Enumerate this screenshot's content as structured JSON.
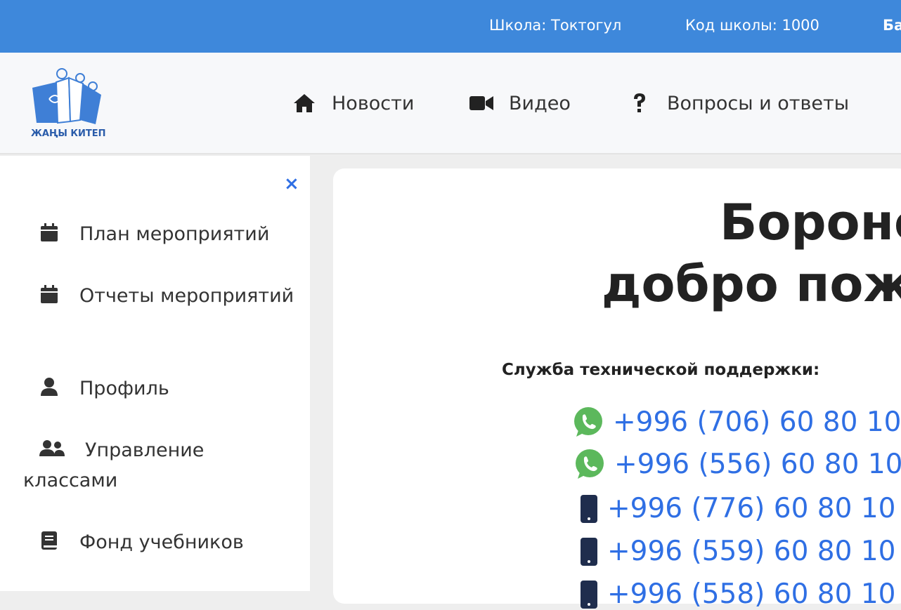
{
  "topbar": {
    "school": "Школа: Токтогул",
    "school_code": "Код школы: 1000",
    "cut_text": "Ба"
  },
  "logo": {
    "text": "ЖАҢЫ КИТЕП"
  },
  "nav": {
    "news": "Новости",
    "video": "Видео",
    "faq": "Вопросы и ответы"
  },
  "sidebar": {
    "close": "×",
    "items": [
      {
        "label": "План мероприятий",
        "icon": "calendar-icon"
      },
      {
        "label": "Отчеты мероприятий",
        "icon": "calendar-icon"
      },
      {
        "label": "Профиль",
        "icon": "user-icon"
      },
      {
        "label": "Управление классами",
        "icon": "users-icon"
      },
      {
        "label": "Фонд учебников",
        "icon": "book-icon"
      }
    ]
  },
  "main": {
    "title_line1": "Бороно",
    "title_line2": "добро пожа",
    "support_label": "Служба технической поддержки:",
    "phones": [
      {
        "number": "+996 (706) 60 80 10",
        "icon": "whatsapp-icon"
      },
      {
        "number": "+996 (556) 60 80 10",
        "icon": "whatsapp-icon"
      },
      {
        "number": "+996 (776) 60 80 10",
        "icon": "mobile-phone-icon"
      },
      {
        "number": "+996 (559) 60 80 10",
        "icon": "mobile-phone-icon"
      },
      {
        "number": "+996 (558) 60 80 10",
        "icon": "mobile-phone-icon"
      }
    ]
  },
  "colors": {
    "topbar": "#3e88db",
    "accent": "#2f6fe4",
    "whatsapp": "#5cb85c",
    "phone_icon": "#1f2d4d"
  }
}
